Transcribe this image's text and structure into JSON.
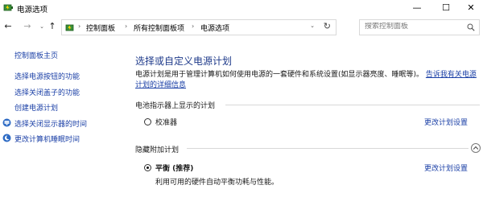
{
  "window": {
    "title": "电源选项",
    "minimize_glyph": "—",
    "maximize_glyph": "☐",
    "close_glyph": "✕"
  },
  "nav": {
    "back_glyph": "←",
    "forward_glyph": "→",
    "up_glyph": "↑",
    "breadcrumbs": [
      "控制面板",
      "所有控制面板项",
      "电源选项"
    ],
    "search_placeholder": "搜索控制面板"
  },
  "sidebar": {
    "home": "控制面板主页",
    "links": [
      {
        "label": "选择电源按钮的功能",
        "icon": ""
      },
      {
        "label": "选择关闭盖子的功能",
        "icon": ""
      },
      {
        "label": "创建电源计划",
        "icon": ""
      },
      {
        "label": "选择关闭显示器的时间",
        "icon": "monitor-icon"
      },
      {
        "label": "更改计算机睡眠时间",
        "icon": "moon-icon"
      }
    ]
  },
  "main": {
    "title": "选择或自定义电源计划",
    "description": "电源计划是用于管理计算机如何使用电源的一套硬件和系统设置(如显示器亮度、睡眠等)。",
    "description_link": "告诉我有关电源计划的详细信息",
    "battery_section": {
      "heading": "电池指示器上显示的计划",
      "plans": [
        {
          "name": "校准器",
          "selected": false,
          "change_link": "更改计划设置"
        }
      ]
    },
    "hidden_section": {
      "heading": "隐藏附加计划",
      "plans": [
        {
          "name": "平衡 (推荐)",
          "selected": true,
          "description": "利用可用的硬件自动平衡功耗与性能。",
          "change_link": "更改计划设置"
        }
      ]
    }
  },
  "colors": {
    "link": "#1a3fa6",
    "title": "#1e3a8a"
  }
}
